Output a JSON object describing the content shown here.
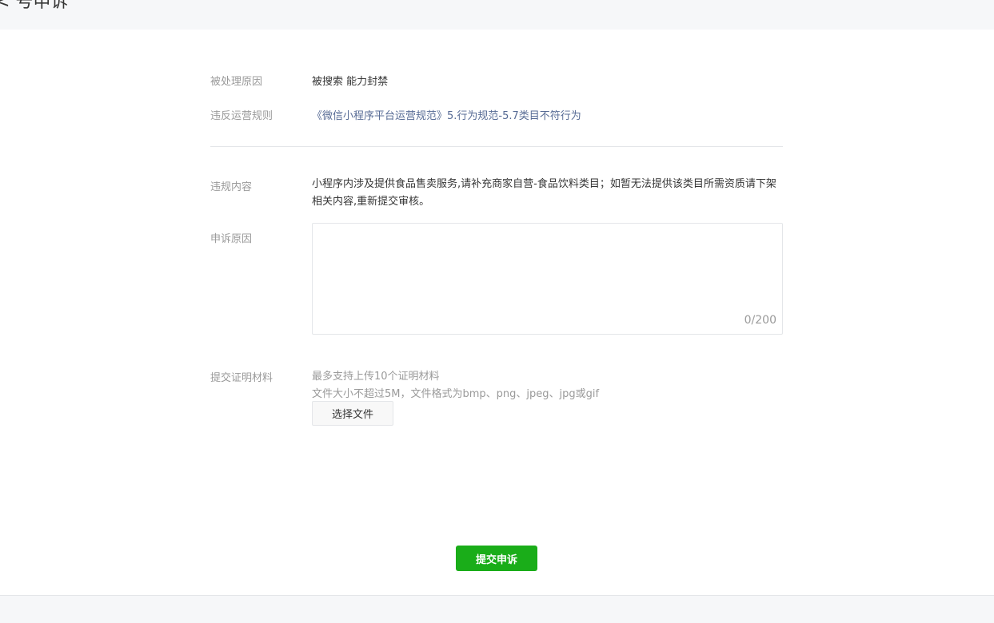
{
  "header": {
    "title": "< 号申诉"
  },
  "details": {
    "reason_label": "被处理原因",
    "reason_value": "被搜索 能力封禁",
    "rule_label": "违反运营规则",
    "rule_link": "《微信小程序平台运营规范》5.行为规范-5.7类目不符行为"
  },
  "violation": {
    "label": "违规内容",
    "text": "小程序内涉及提供食品售卖服务,请补充商家自营-食品饮料类目；如暂无法提供该类目所需资质请下架相关内容,重新提交审核。"
  },
  "appeal": {
    "label": "申诉原因",
    "value": "",
    "placeholder": "",
    "counter": "0/200"
  },
  "evidence": {
    "label": "提交证明材料",
    "hint_count": "最多支持上传10个证明材料",
    "hint_format": "文件大小不超过5M，文件格式为bmp、png、jpeg、jpg或gif",
    "choose_file_label": "选择文件"
  },
  "actions": {
    "submit_label": "提交申诉"
  },
  "colors": {
    "accent": "#1aad19",
    "link": "#576b95"
  }
}
